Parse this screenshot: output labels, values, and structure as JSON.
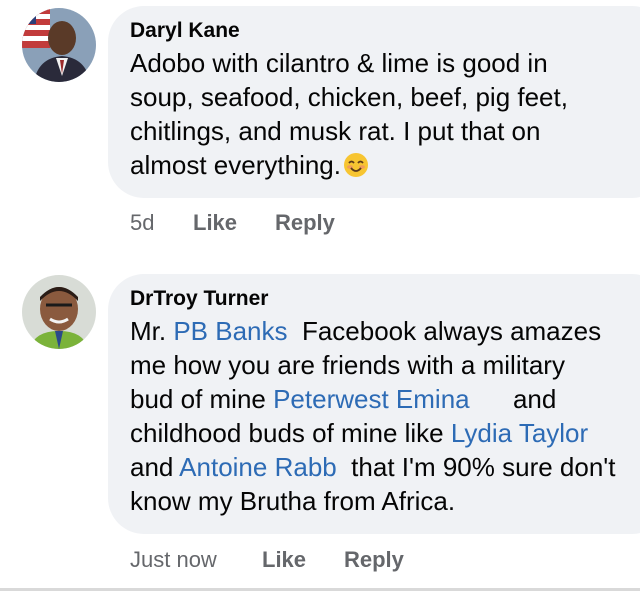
{
  "comments": [
    {
      "author": "Daryl Kane",
      "text_lines": [
        "Adobo with cilantro & lime is good in",
        "soup, seafood, chicken, beef, pig feet,",
        "chitlings, and musk rat. I put that on",
        "almost everything."
      ],
      "emoji": "smiling-face-emoji",
      "time": "5d",
      "like_label": "Like",
      "reply_label": "Reply"
    },
    {
      "author": "DrTroy Turner",
      "segments": {
        "s1": "Mr. ",
        "m1": "PB Banks",
        "s2": "  Facebook always amazes",
        "s3": "me how you are friends with a military",
        "s4": "bud of mine ",
        "m2": "Peterwest Emina",
        "s5": "      and",
        "s6": "childhood buds of mine like ",
        "m3": "Lydia Taylor",
        "s7": "and ",
        "m4": "Antoine Rabb",
        "s8": "  that I'm 90% sure don't",
        "s9": "know my Brutha from Africa."
      },
      "time": "Just now",
      "like_label": "Like",
      "reply_label": "Reply"
    }
  ],
  "colors": {
    "bubble": "#f0f2f5",
    "mention": "#2d6bb5",
    "meta": "#65676b"
  }
}
